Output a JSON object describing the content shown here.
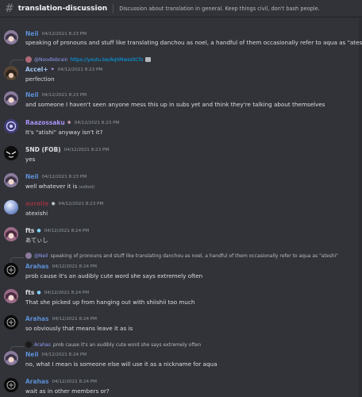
{
  "channel": {
    "name": "translation-discussion",
    "topic": "Discussion about translation in general. Keep things civil, don't bash people."
  },
  "messages": [
    {
      "user": "Neil",
      "ts": "04/12/2021 8:23 PM",
      "text": "speaking of pronouns and stuff like translating danchou as noel, a handful of them occasionally refer to aqua as \"ateshi\"",
      "color": "#5d8ed6",
      "avatar": "anime-avatar-purple"
    },
    {
      "user": "Accel+",
      "ts": "04/12/2021 8:23 PM",
      "text": "perfection",
      "color": "#a3c4f3",
      "avatar": "anime-avatar-brown",
      "reply": {
        "mention": "@Noodlebrain",
        "link": "https://youtu.be/AqhMwss0Cfo"
      }
    },
    {
      "user": "Neil",
      "ts": "04/12/2021 8:23 PM",
      "text": "and someone I haven't seen anyone mess this up in subs yet and think they're talking about themselves",
      "color": "#5d8ed6",
      "avatar": "anime-avatar-purple"
    },
    {
      "user": "Raazossaku",
      "ts": "04/12/2021 8:23 PM",
      "text": "It's \"atishi\" anyway isn't it?",
      "color": "#a892f5",
      "avatar": "circle-emblem-avatar"
    },
    {
      "user": "SND (FOB)",
      "ts": "04/12/2021 8:23 PM",
      "text": "yes",
      "color": "#dbdee1",
      "avatar": "black-white-avatar"
    },
    {
      "user": "Neil",
      "ts": "04/12/2021 8:23 PM",
      "text": "well whatever it is",
      "edited": "(edited)",
      "color": "#5d8ed6",
      "avatar": "anime-avatar-purple"
    },
    {
      "user": "aurelie",
      "ts": "04/12/2021 8:23 PM",
      "text": "atexishi",
      "color": "#8f3340",
      "avatar": "orb-avatar"
    },
    {
      "user": "fts",
      "ts": "04/12/2021 8:24 PM",
      "text": "あてぃし",
      "color": "#dbdee1",
      "avatar": "anime-avatar-pink"
    },
    {
      "user": "Arahas",
      "ts": "04/12/2021 8:24 PM",
      "text": "prob cause it's an audibly cute word she says extremely often",
      "color": "#5d8ed6",
      "avatar": "dark-emblem-avatar",
      "reply": {
        "mention": "@Neil",
        "text": "speaking of pronouns and stuff like translating danchou as noel, a handful of them occasionally refer to aqua as \"ateshi\""
      }
    },
    {
      "user": "fts",
      "ts": "04/12/2021 8:24 PM",
      "text": "That she picked up from hanging out with shiishii too much",
      "color": "#dbdee1",
      "avatar": "anime-avatar-pink"
    },
    {
      "user": "Arahas",
      "ts": "04/12/2021 8:24 PM",
      "text": "so obviously that means leave it as is",
      "color": "#5d8ed6",
      "avatar": "dark-emblem-avatar"
    },
    {
      "user": "Neil",
      "ts": "04/12/2021 8:24 PM",
      "text": "no, what I mean is someone else will use it as a nickname for aqua",
      "color": "#5d8ed6",
      "avatar": "anime-avatar-purple",
      "reply": {
        "mention": "Arahas",
        "text": "prob cause it's an audibly cute word she says extremely often"
      }
    },
    {
      "user": "Arahas",
      "ts": "04/12/2021 8:24 PM",
      "text": "wait as in other members or?",
      "color": "#5d8ed6",
      "avatar": "dark-emblem-avatar"
    }
  ]
}
